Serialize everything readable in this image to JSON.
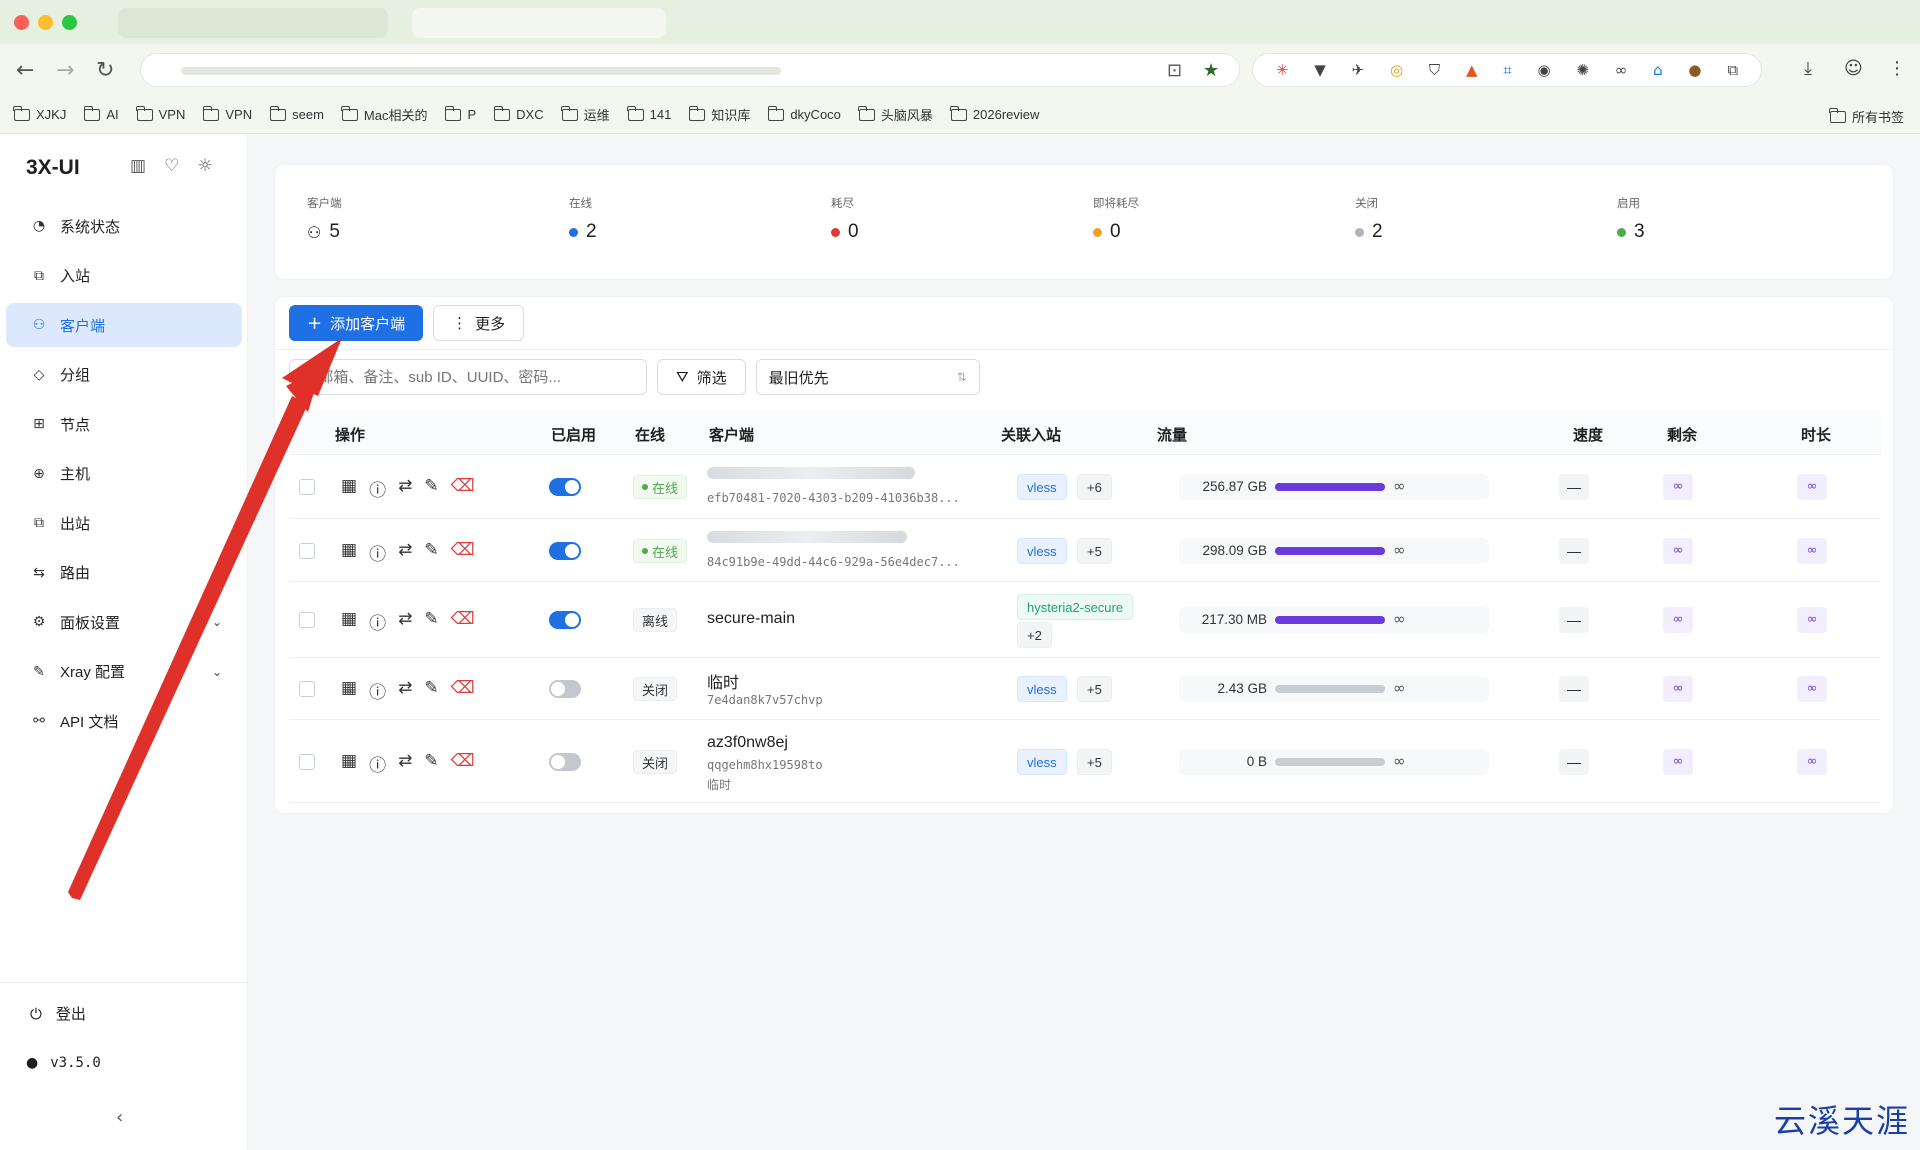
{
  "bookmarks": [
    "XJKJ",
    "AI",
    "VPN",
    "VPN",
    "seem",
    "Mac相关的",
    "P",
    "DXC",
    "运维",
    "141",
    "知识库",
    "dkyCoco",
    "头脑风暴",
    "2026review"
  ],
  "bookmarks_all": "所有书签",
  "brand": "3X-UI",
  "menu": [
    {
      "icon": "dashboard-icon",
      "glyph": "◔",
      "label": "系统状态"
    },
    {
      "icon": "inbound-icon",
      "glyph": "⧉",
      "label": "入站"
    },
    {
      "icon": "clients-icon",
      "glyph": "⚇",
      "label": "客户端"
    },
    {
      "icon": "tag-icon",
      "glyph": "◇",
      "label": "分组"
    },
    {
      "icon": "nodes-icon",
      "glyph": "⊞",
      "label": "节点"
    },
    {
      "icon": "globe-icon",
      "glyph": "⊕",
      "label": "主机"
    },
    {
      "icon": "outbound-icon",
      "glyph": "⧉",
      "label": "出站"
    },
    {
      "icon": "route-icon",
      "glyph": "⇆",
      "label": "路由"
    },
    {
      "icon": "gear-icon",
      "glyph": "⚙",
      "label": "面板设置"
    },
    {
      "icon": "tool-icon",
      "glyph": "✎",
      "label": "Xray 配置"
    },
    {
      "icon": "api-icon",
      "glyph": "⚯",
      "label": "API 文档"
    }
  ],
  "logout": "登出",
  "version": "v3.5.0",
  "stats": [
    {
      "label": "客户端",
      "value": "5",
      "color": ""
    },
    {
      "label": "在线",
      "value": "2",
      "color": "#1f6fe5"
    },
    {
      "label": "耗尽",
      "value": "0",
      "color": "#e03b3b"
    },
    {
      "label": "即将耗尽",
      "value": "0",
      "color": "#f0a020"
    },
    {
      "label": "关闭",
      "value": "2",
      "color": "#b0b4ba"
    },
    {
      "label": "启用",
      "value": "3",
      "color": "#52a94a"
    }
  ],
  "toolbar": {
    "add_label": "添加客户端",
    "more_label": "更多"
  },
  "filters": {
    "search_placeholder": "邮箱、备注、sub ID、UUID、密码...",
    "filter_label": "筛选",
    "sort_label": "最旧优先"
  },
  "columns": [
    "操作",
    "已启用",
    "在线",
    "客户端",
    "关联入站",
    "流量",
    "速度",
    "剩余",
    "时长"
  ],
  "rows": [
    {
      "enabled": true,
      "status": "在线",
      "online": true,
      "name": "",
      "sub": "efb70481-7020-4303-b209-41036b38...",
      "note": "",
      "tag": "vless",
      "more": "+6",
      "traffic": "256.87 GB",
      "used": true,
      "speed": "—",
      "remain": "∞",
      "duration": "∞"
    },
    {
      "enabled": true,
      "status": "在线",
      "online": true,
      "name": "",
      "sub": "84c91b9e-49dd-44c6-929a-56e4dec7...",
      "note": "",
      "tag": "vless",
      "more": "+5",
      "traffic": "298.09 GB",
      "used": true,
      "speed": "—",
      "remain": "∞",
      "duration": "∞"
    },
    {
      "enabled": true,
      "status": "离线",
      "online": false,
      "name": "secure-main",
      "sub": "",
      "note": "",
      "tag": "hysteria2-secure",
      "more": "+2",
      "traffic": "217.30 MB",
      "used": true,
      "speed": "—",
      "remain": "∞",
      "duration": "∞"
    },
    {
      "enabled": false,
      "status": "关闭",
      "online": false,
      "name": "临时",
      "sub": "7e4dan8k7v57chvp",
      "note": "",
      "tag": "vless",
      "more": "+5",
      "traffic": "2.43 GB",
      "used": false,
      "speed": "—",
      "remain": "∞",
      "duration": "∞"
    },
    {
      "enabled": false,
      "status": "关闭",
      "online": false,
      "name": "az3f0nw8ej",
      "sub": "qqgehm8hx19598to",
      "note": "临时",
      "tag": "vless",
      "more": "+5",
      "traffic": "0 B",
      "used": false,
      "speed": "—",
      "remain": "∞",
      "duration": "∞"
    }
  ],
  "watermark": "云溪天涯"
}
